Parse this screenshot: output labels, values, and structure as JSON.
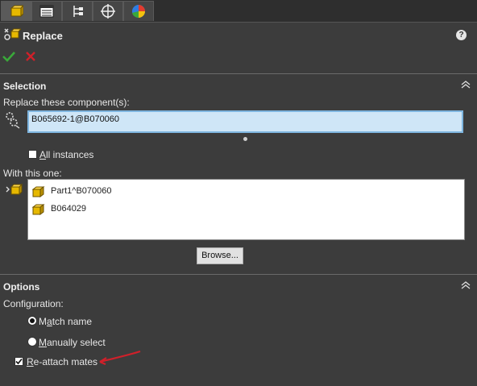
{
  "tabs": [
    {
      "icon": "property-manager-icon",
      "active": true
    },
    {
      "icon": "feature-tree-icon",
      "active": false
    },
    {
      "icon": "configuration-manager-icon",
      "active": false
    },
    {
      "icon": "dimxpert-icon",
      "active": false
    },
    {
      "icon": "display-manager-icon",
      "active": false
    }
  ],
  "header": {
    "title": "Replace",
    "help": "?"
  },
  "actions": {
    "ok_icon": "check-icon",
    "cancel_icon": "x-icon"
  },
  "selection": {
    "title": "Selection",
    "replace_label": "Replace these component(s):",
    "replace_value": "B065692-1@B070060",
    "all_instances": {
      "label_accel": "A",
      "label_rest": "ll instances",
      "checked": false
    },
    "with_label": "With this one:",
    "with_items": [
      {
        "label": "Part1^B070060"
      },
      {
        "label": "B064029"
      }
    ],
    "browse_label": "Browse..."
  },
  "options": {
    "title": "Options",
    "configuration_label": "Configuration:",
    "match_name": {
      "before": "M",
      "accel": "a",
      "after": "tch name",
      "selected": true
    },
    "manually_select": {
      "accel": "M",
      "after": "anually select",
      "selected": false
    },
    "reattach_mates": {
      "accel": "R",
      "after": "e-attach mates",
      "checked": true
    }
  },
  "colors": {
    "panel_bg": "#3c3c3c",
    "selection_bg": "#cfe6f7",
    "accent_red": "#d0202a",
    "ok_green": "#3aa83a"
  }
}
